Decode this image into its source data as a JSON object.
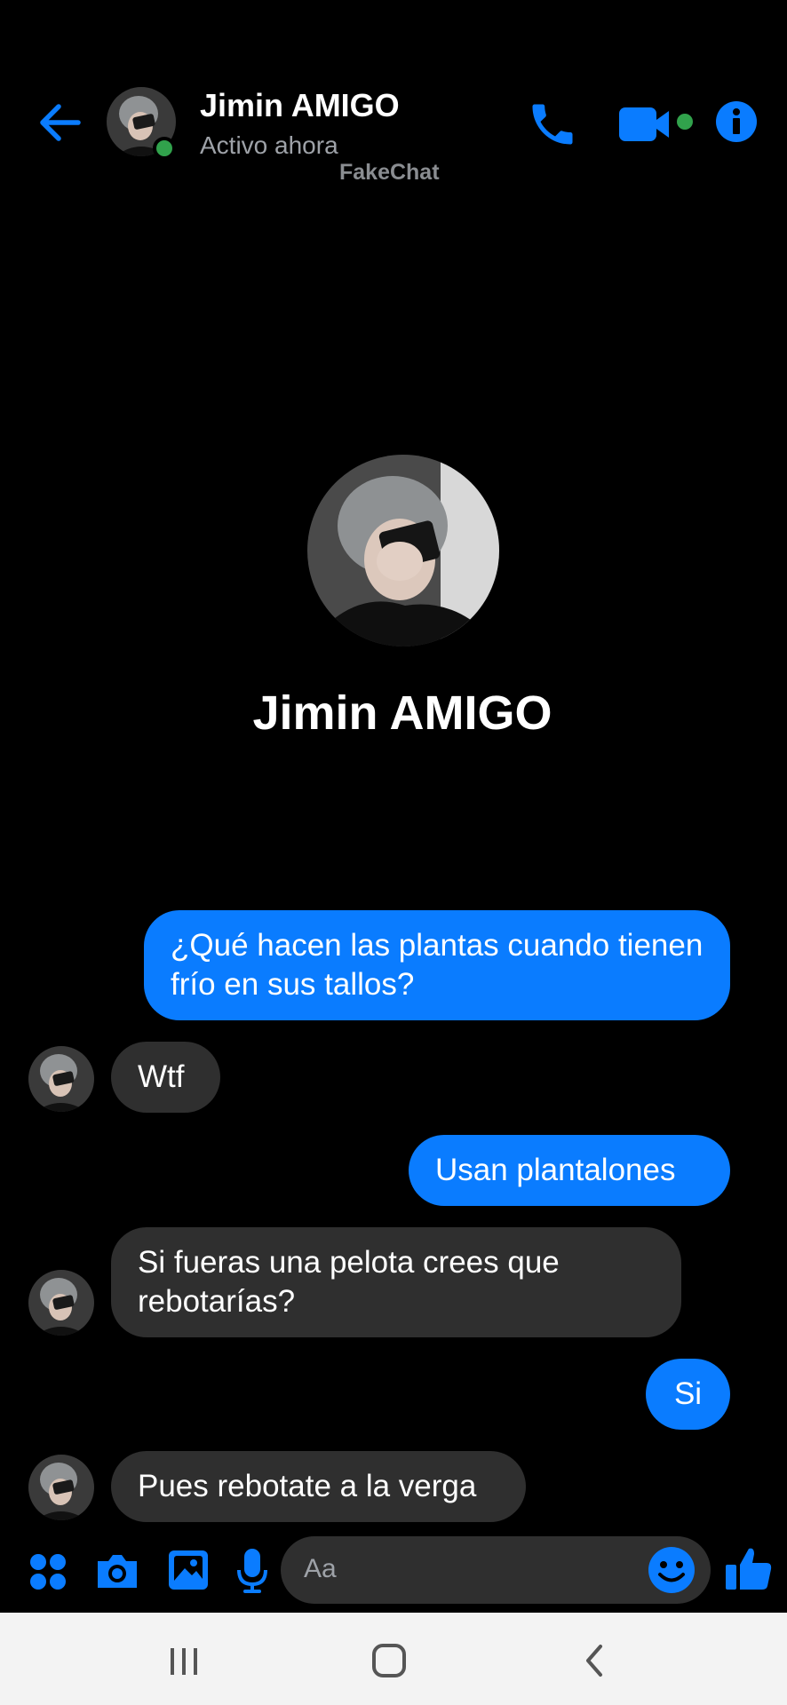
{
  "header": {
    "contact_name": "Jimin AMIGO",
    "status": "Activo ahora",
    "watermark": "FakeChat"
  },
  "profile": {
    "name": "Jimin AMIGO"
  },
  "messages": [
    {
      "from": "me",
      "text": "¿Qué hacen las plantas cuando tienen frío en sus tallos?"
    },
    {
      "from": "contact",
      "text": "Wtf"
    },
    {
      "from": "me",
      "text": "Usan plantalones"
    },
    {
      "from": "contact",
      "text": "Si fueras una pelota crees que rebotarías?"
    },
    {
      "from": "me",
      "text": "Si"
    },
    {
      "from": "contact",
      "text": "Pues rebotate a la verga"
    }
  ],
  "composer": {
    "placeholder": "Aa"
  },
  "colors": {
    "accent": "#0a7cff",
    "incoming_bubble": "#2f2f2f",
    "online": "#31a24c",
    "background": "#000000"
  },
  "icons": [
    "back-arrow-icon",
    "phone-icon",
    "video-camera-icon",
    "info-icon",
    "apps-icon",
    "camera-icon",
    "gallery-icon",
    "microphone-icon",
    "emoji-icon",
    "thumbs-up-icon",
    "recent-apps-icon",
    "home-icon",
    "back-chevron-icon"
  ]
}
